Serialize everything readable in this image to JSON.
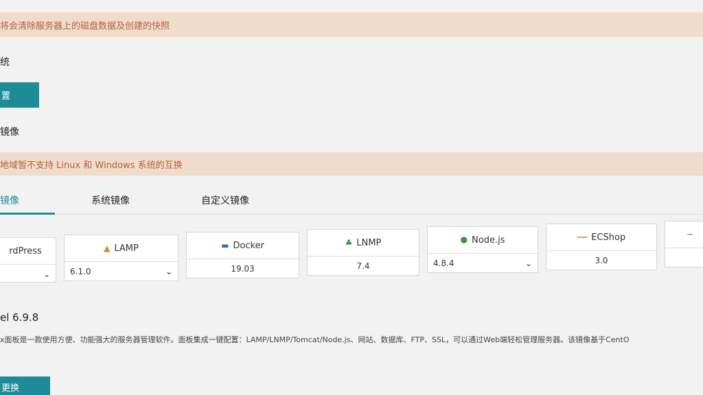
{
  "banners": {
    "top": "将会清除服务器上的磁盘数据及创建的快照",
    "region": "地域暂不支持 Linux 和 Windows 系统的互换"
  },
  "labels": {
    "system": "统",
    "reset_button": "置",
    "image": "镜像"
  },
  "tabs": [
    {
      "label": "镜像",
      "active": true
    },
    {
      "label": "系统镜像",
      "active": false
    },
    {
      "label": "自定义镜像",
      "active": false
    }
  ],
  "cards": [
    {
      "name": "rdPress",
      "icon": "",
      "version": "",
      "has_select": true
    },
    {
      "name": "LAMP",
      "icon": "lamp-icon",
      "version": "6.1.0",
      "has_select": true
    },
    {
      "name": "Docker",
      "icon": "docker-icon",
      "version": "19.03",
      "has_select": false
    },
    {
      "name": "LNMP",
      "icon": "lnmp-icon",
      "version": "7.4",
      "has_select": false
    },
    {
      "name": "Node.js",
      "icon": "nodejs-icon",
      "version": "4.8.4",
      "has_select": true
    },
    {
      "name": "ECShop",
      "icon": "ecshop-icon",
      "version": "3.0",
      "has_select": false
    },
    {
      "name": "",
      "icon": "",
      "version": "",
      "has_select": false
    }
  ],
  "detail": {
    "version": "el 6.9.8",
    "description": "x面板是一款使用方便、功能强大的服务器管理软件。面板集成一键配置：LAMP/LNMP/Tomcat/Node.js、网站、数据库、FTP、SSL，可以通过Web端轻松管理服务器。该镜像基于CentO"
  },
  "bottom_button": "更换",
  "colors": {
    "accent": "#1e8c98",
    "banner_bg": "#efdccb",
    "banner_text": "#b5603a"
  }
}
